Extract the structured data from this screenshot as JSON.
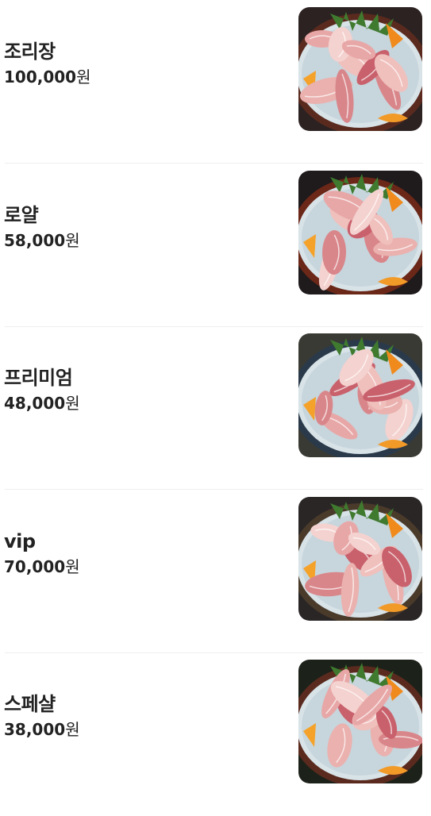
{
  "currency_unit": "원",
  "items": [
    {
      "name": "조리장",
      "price": "100,000",
      "image_icon": "tuna-sashimi-platter-image"
    },
    {
      "name": "로얄",
      "price": "58,000",
      "image_icon": "tuna-sashimi-platter-image"
    },
    {
      "name": "프리미엄",
      "price": "48,000",
      "image_icon": "tuna-sashimi-platter-image"
    },
    {
      "name": "vip",
      "price": "70,000",
      "image_icon": "tuna-sashimi-platter-image"
    },
    {
      "name": "스페샬",
      "price": "38,000",
      "image_icon": "tuna-sashimi-platter-image"
    }
  ]
}
